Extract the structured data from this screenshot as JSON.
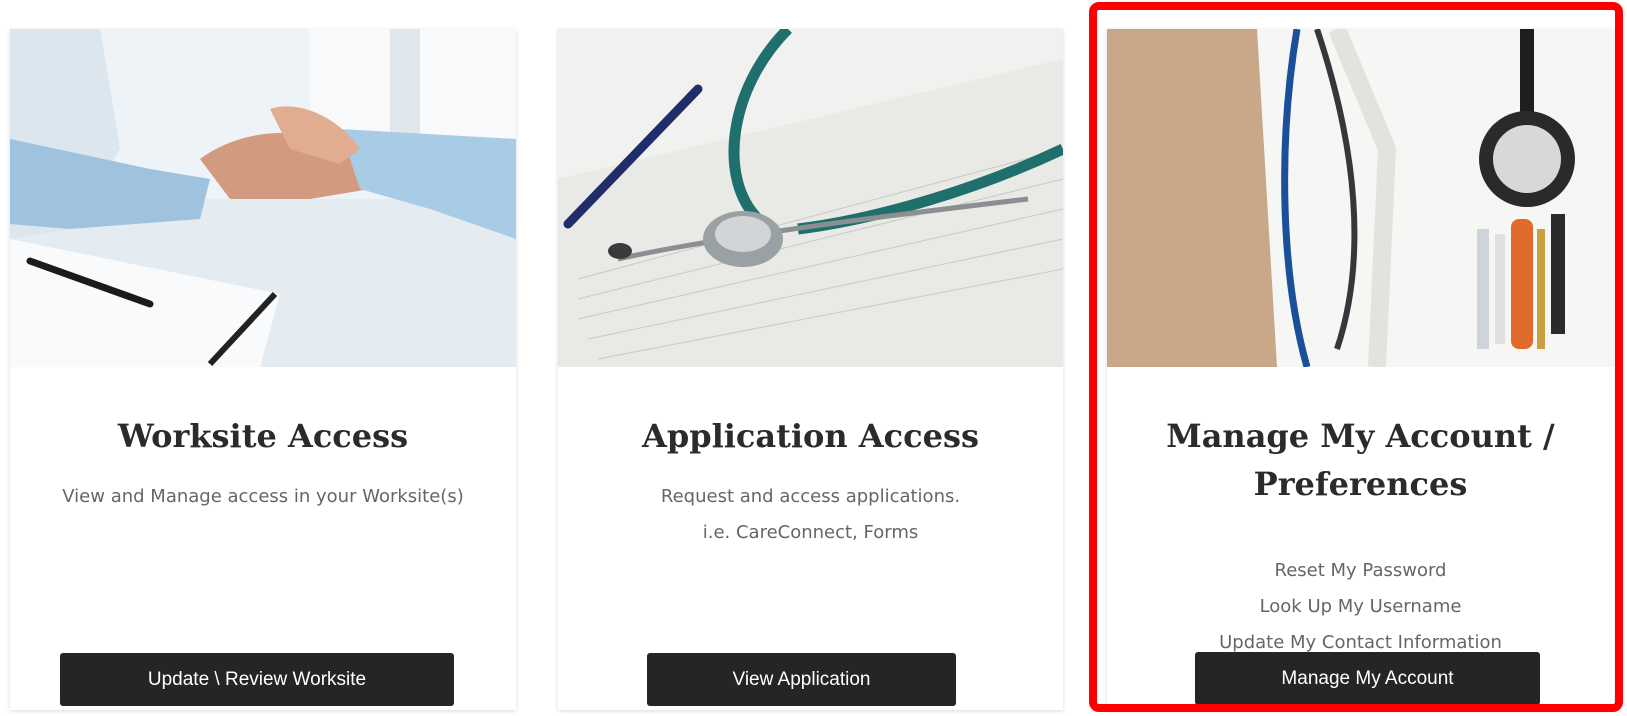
{
  "cards": [
    {
      "title": "Worksite Access",
      "description": [
        "View and Manage access in your Worksite(s)"
      ],
      "button_label": "Update \\ Review Worksite",
      "image": "doctor-patient-handshake-photo"
    },
    {
      "title": "Application Access",
      "description": [
        "Request and access applications.",
        "i.e. CareConnect, Forms"
      ],
      "button_label": "View Application",
      "image": "stethoscope-on-forms-photo"
    },
    {
      "title": "Manage My Account / Preferences",
      "description": [
        "Reset My Password",
        "Look Up My Username",
        "Update My Contact Information"
      ],
      "button_label": "Manage My Account",
      "image": "doctor-coat-stethoscope-photo"
    }
  ],
  "highlight_color": "#ff0000",
  "button_color": "#252525"
}
